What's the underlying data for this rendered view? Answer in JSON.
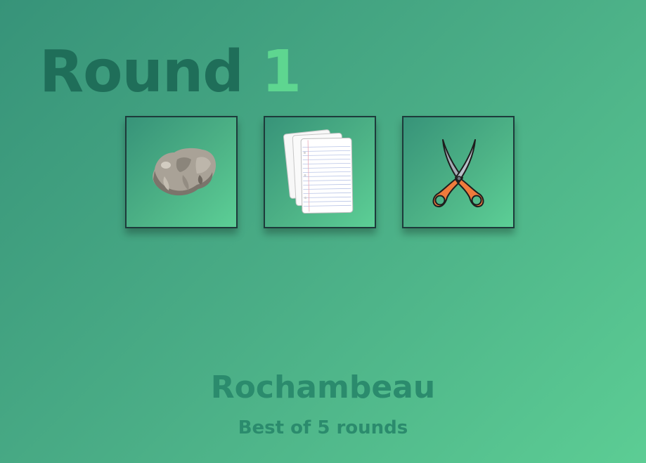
{
  "round": {
    "label": "Round",
    "number": "1"
  },
  "choices": [
    {
      "name": "rock",
      "icon": "rock-icon"
    },
    {
      "name": "paper",
      "icon": "paper-icon"
    },
    {
      "name": "scissors",
      "icon": "scissors-icon"
    }
  ],
  "footer": {
    "title": "Rochambeau",
    "subtitle": "Best of 5 rounds"
  },
  "colors": {
    "round_label": "#1f6e59",
    "round_number": "#5ed690",
    "footer_text": "#2b8b6d",
    "tile_border": "#1d3b3b"
  }
}
